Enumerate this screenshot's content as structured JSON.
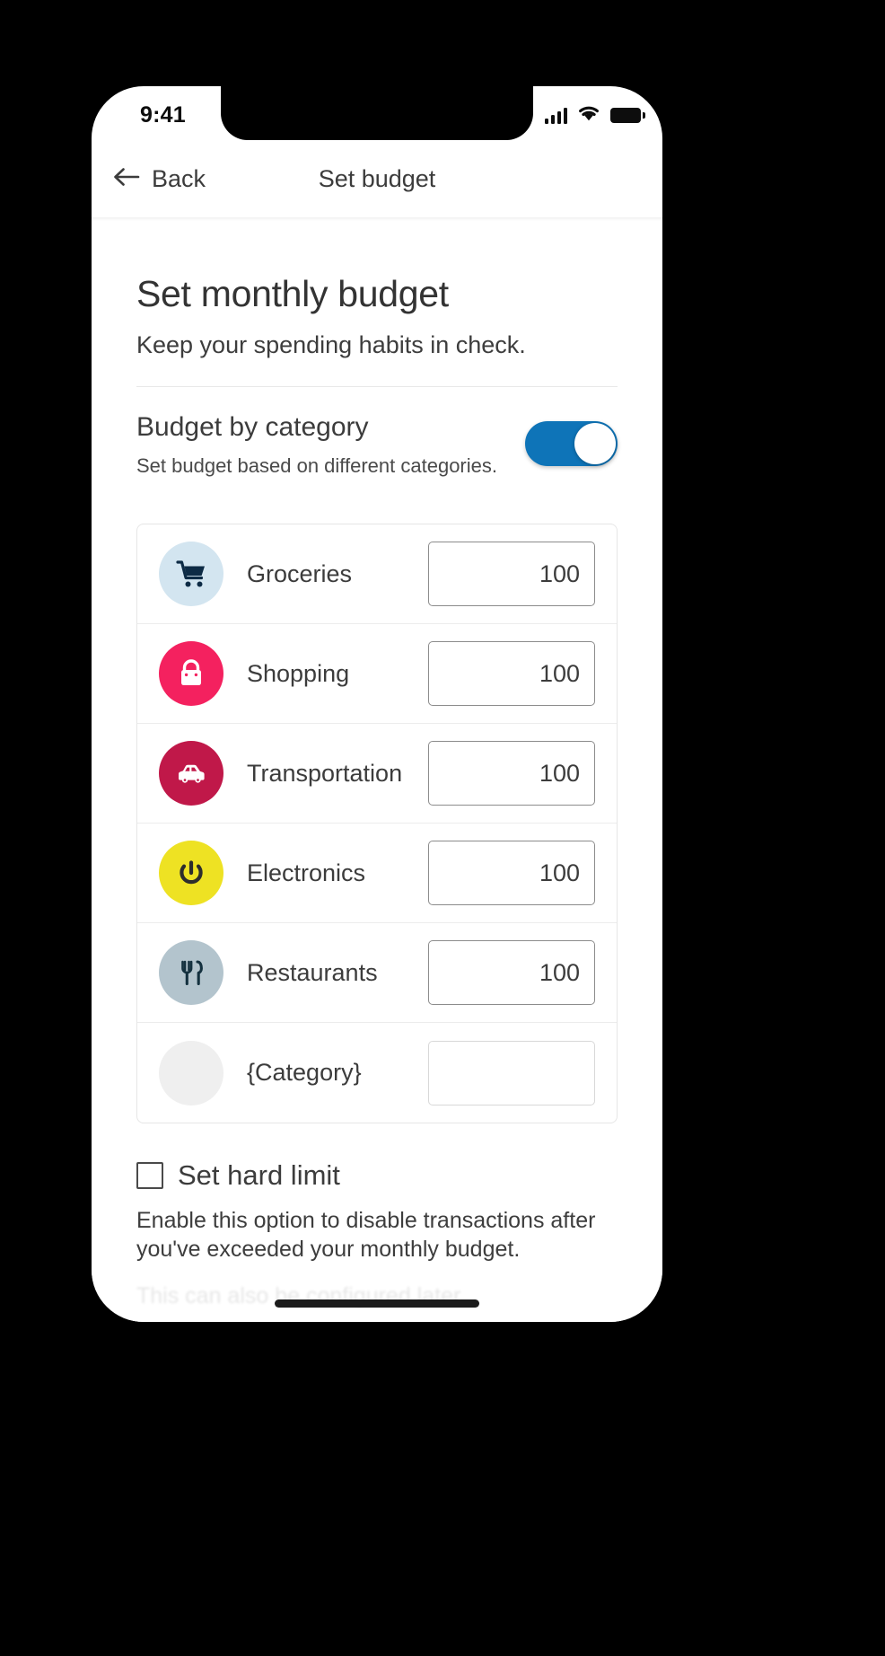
{
  "status_bar": {
    "time": "9:41",
    "signal_icon": "cellular-signal-icon",
    "wifi_icon": "wifi-icon",
    "battery_icon": "battery-full-icon"
  },
  "nav": {
    "back_label": "Back",
    "back_icon": "arrow-left-icon",
    "title": "Set budget"
  },
  "page": {
    "title": "Set monthly budget",
    "subtitle": "Keep your spending habits in check."
  },
  "budget_by_category": {
    "title": "Budget by category",
    "description": "Set budget based on different categories.",
    "toggle_state": "on",
    "toggle_color": "#0e74b8"
  },
  "categories": [
    {
      "label": "Groceries",
      "value": "100",
      "icon": "shopping-cart-icon",
      "circle_color": "#d3e5f0",
      "icon_color": "#0d2b45"
    },
    {
      "label": "Shopping",
      "value": "100",
      "icon": "shopping-bag-icon",
      "circle_color": "#f4215f",
      "icon_color": "#ffffff"
    },
    {
      "label": "Transportation",
      "value": "100",
      "icon": "car-icon",
      "circle_color": "#c01849",
      "icon_color": "#ffffff"
    },
    {
      "label": "Electronics",
      "value": "100",
      "icon": "power-icon",
      "circle_color": "#eee223",
      "icon_color": "#2d2d2d"
    },
    {
      "label": "Restaurants",
      "value": "100",
      "icon": "fork-knife-icon",
      "circle_color": "#b3c4cd",
      "icon_color": "#14313f"
    },
    {
      "label": "{Category}",
      "value": "",
      "icon": "empty-category-icon",
      "circle_color": "#efefef",
      "icon_color": "#efefef"
    }
  ],
  "hard_limit": {
    "label": "Set hard limit",
    "checked": false,
    "description": "Enable this option to disable transactions after you've exceeded your monthly budget."
  },
  "footer": {
    "faded_text": "This can also be configured later."
  }
}
